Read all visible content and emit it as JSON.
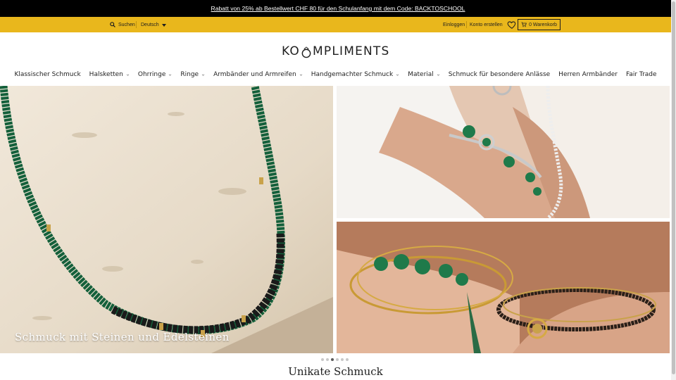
{
  "announcement": {
    "text": "Rabatt von 25% ab Bestellwert CHF 80 für den Schulanfang mit dem Code: BACKTOSCHOOL"
  },
  "utility": {
    "search_label": "Suchen",
    "language_selected": "Deutsch",
    "login_label": "Einloggen",
    "signup_label": "Konto erstellen",
    "cart_label": "0 Warenkorb",
    "icons": [
      "search-icon",
      "chevron-down-icon",
      "heart-icon",
      "cart-icon"
    ]
  },
  "logo": {
    "before": "KO",
    "after": "MPLIMENTS"
  },
  "nav": {
    "items": [
      {
        "label": "Klassischer Schmuck",
        "dropdown": false
      },
      {
        "label": "Halsketten",
        "dropdown": true
      },
      {
        "label": "Ohrringe",
        "dropdown": true
      },
      {
        "label": "Ringe",
        "dropdown": true
      },
      {
        "label": "Armbänder und Armreifen",
        "dropdown": true
      },
      {
        "label": "Handgemachter Schmuck",
        "dropdown": true
      },
      {
        "label": "Material",
        "dropdown": true
      },
      {
        "label": "Schmuck für besondere Anlässe",
        "dropdown": false
      },
      {
        "label": "Herren Armbänder",
        "dropdown": false
      },
      {
        "label": "Fair Trade",
        "dropdown": false
      }
    ]
  },
  "hero": {
    "caption": "Schmuck mit Steinen und Edelsteinen",
    "slide_count": 6,
    "active_slide": 3
  },
  "section": {
    "title": "Unikate Schmuck"
  },
  "colors": {
    "announcement_bg": "#000000",
    "utility_bg": "#e9b71c",
    "stone_green": "#1f7a4a"
  }
}
